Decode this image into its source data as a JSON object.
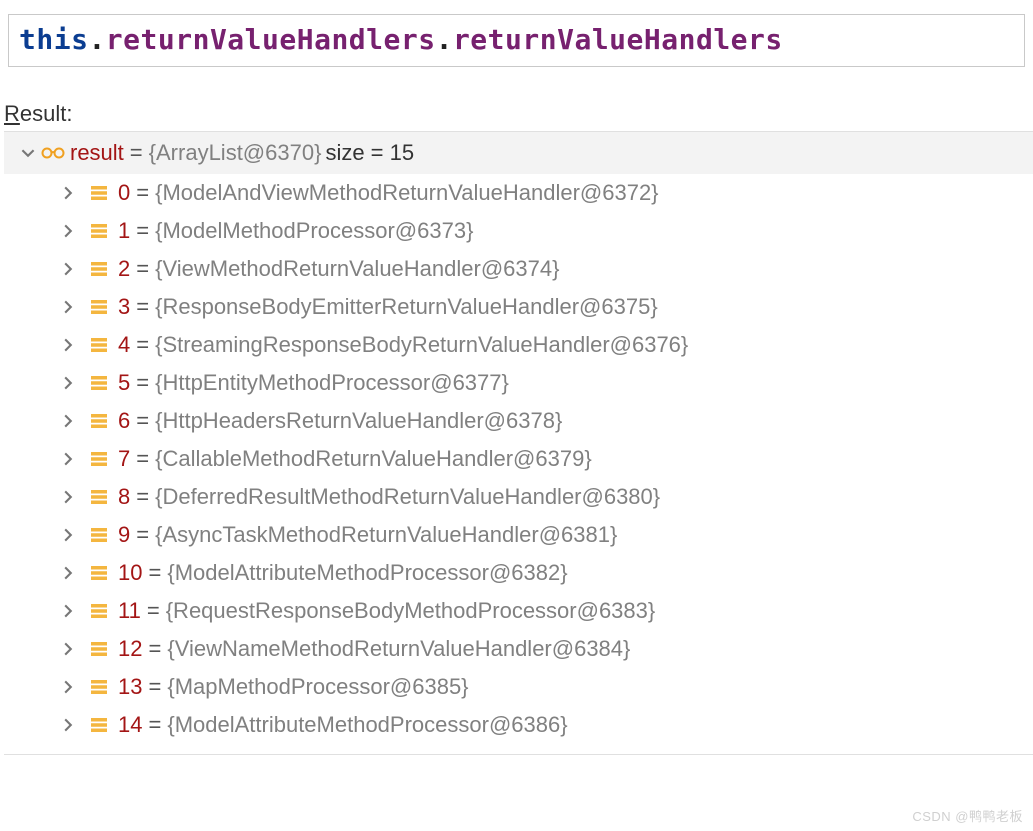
{
  "expression": {
    "keyword": "this",
    "chain1": "returnValueHandlers",
    "chain2": "returnValueHandlers"
  },
  "result_label_prefix": "R",
  "result_label_rest": "esult:",
  "result": {
    "name": "result",
    "equals": " = ",
    "type_display": "{ArrayList@6370}",
    "size_label": "  size = 15"
  },
  "items": [
    {
      "index": "0",
      "equals": " = ",
      "value": "{ModelAndViewMethodReturnValueHandler@6372}"
    },
    {
      "index": "1",
      "equals": " = ",
      "value": "{ModelMethodProcessor@6373}"
    },
    {
      "index": "2",
      "equals": " = ",
      "value": "{ViewMethodReturnValueHandler@6374}"
    },
    {
      "index": "3",
      "equals": " = ",
      "value": "{ResponseBodyEmitterReturnValueHandler@6375}"
    },
    {
      "index": "4",
      "equals": " = ",
      "value": "{StreamingResponseBodyReturnValueHandler@6376}"
    },
    {
      "index": "5",
      "equals": " = ",
      "value": "{HttpEntityMethodProcessor@6377}"
    },
    {
      "index": "6",
      "equals": " = ",
      "value": "{HttpHeadersReturnValueHandler@6378}"
    },
    {
      "index": "7",
      "equals": " = ",
      "value": "{CallableMethodReturnValueHandler@6379}"
    },
    {
      "index": "8",
      "equals": " = ",
      "value": "{DeferredResultMethodReturnValueHandler@6380}"
    },
    {
      "index": "9",
      "equals": " = ",
      "value": "{AsyncTaskMethodReturnValueHandler@6381}"
    },
    {
      "index": "10",
      "equals": " = ",
      "value": "{ModelAttributeMethodProcessor@6382}"
    },
    {
      "index": "11",
      "equals": " = ",
      "value": "{RequestResponseBodyMethodProcessor@6383}"
    },
    {
      "index": "12",
      "equals": " = ",
      "value": "{ViewNameMethodReturnValueHandler@6384}"
    },
    {
      "index": "13",
      "equals": " = ",
      "value": "{MapMethodProcessor@6385}"
    },
    {
      "index": "14",
      "equals": " = ",
      "value": "{ModelAttributeMethodProcessor@6386}"
    }
  ],
  "watermark": "CSDN @鸭鸭老板"
}
